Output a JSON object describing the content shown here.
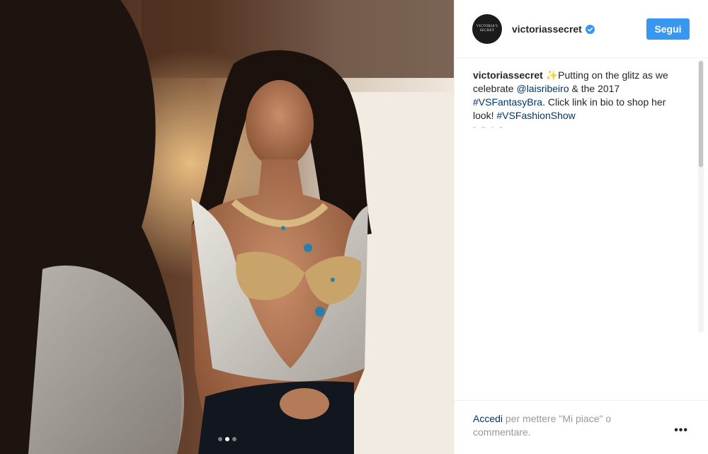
{
  "account": {
    "username": "victoriassecret",
    "avatar_text": "VICTORIA'S SECRET",
    "verified": true,
    "follow_label": "Segui",
    "accent_color": "#3897f0"
  },
  "caption": {
    "username": "victoriassecret",
    "emoji": "✨",
    "part1": "Putting on the glitz as we celebrate ",
    "mention": "@laisribeiro",
    "part2": " & the 2017 ",
    "hashtag1": "#VSFantasyBra",
    "part3": ". Click link in bio to shop her look! ",
    "hashtag2": "#VSFashionShow"
  },
  "footer": {
    "login_link": "Accedi",
    "login_text": " per mettere \"Mi piace\" o commentare.",
    "more_icon": "more-options-icon"
  },
  "carousel": {
    "count": 3,
    "active_index": 1
  }
}
